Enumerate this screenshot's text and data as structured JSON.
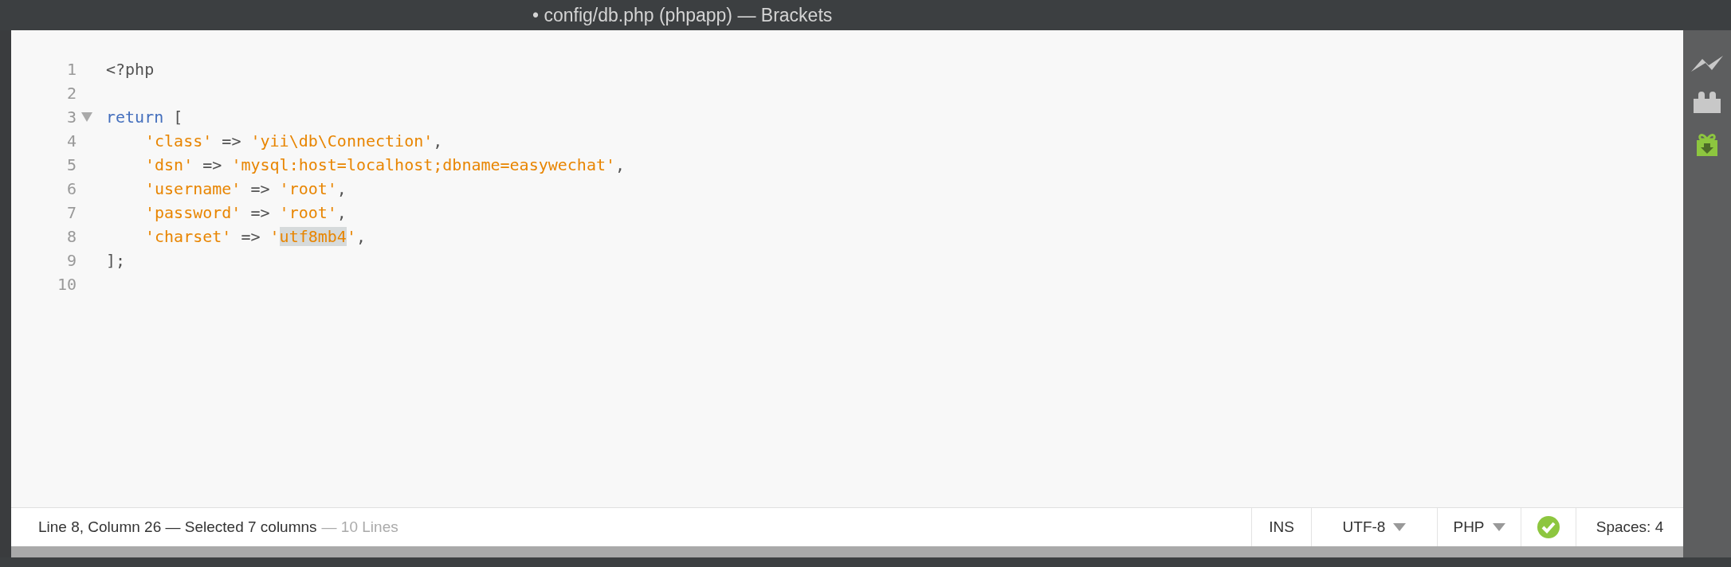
{
  "window": {
    "title": "• config/db.php (phpapp) — Brackets"
  },
  "editor": {
    "lines": [
      {
        "number": "1",
        "fold": false,
        "tokens": [
          {
            "text": "<?php",
            "kind": "plain"
          }
        ]
      },
      {
        "number": "2",
        "fold": false
      },
      {
        "number": "3",
        "fold": true,
        "tokens": [
          {
            "text": "return",
            "kind": "keyword"
          },
          {
            "text": " [",
            "kind": "plain"
          }
        ],
        "children": [
          {
            "number": "4",
            "fold": false,
            "tokens": [
              {
                "text": "'class'",
                "kind": "string"
              },
              {
                "text": " => ",
                "kind": "plain"
              },
              {
                "text": "'yii\\db\\Connection'",
                "kind": "string"
              },
              {
                "text": ",",
                "kind": "plain"
              }
            ]
          },
          {
            "number": "5",
            "fold": false,
            "tokens": [
              {
                "text": "'dsn'",
                "kind": "string"
              },
              {
                "text": " => ",
                "kind": "plain"
              },
              {
                "text": "'mysql:host=localhost;dbname=easywechat'",
                "kind": "string"
              },
              {
                "text": ",",
                "kind": "plain"
              }
            ]
          },
          {
            "number": "6",
            "fold": false,
            "tokens": [
              {
                "text": "'username'",
                "kind": "string"
              },
              {
                "text": " => ",
                "kind": "plain"
              },
              {
                "text": "'root'",
                "kind": "string"
              },
              {
                "text": ",",
                "kind": "plain"
              }
            ]
          },
          {
            "number": "7",
            "fold": false,
            "tokens": [
              {
                "text": "'password'",
                "kind": "string"
              },
              {
                "text": " => ",
                "kind": "plain"
              },
              {
                "text": "'root'",
                "kind": "string"
              },
              {
                "text": ",",
                "kind": "plain"
              }
            ]
          },
          {
            "number": "8",
            "fold": false,
            "tokens": [
              {
                "text": "'charset'",
                "kind": "string"
              },
              {
                "text": " => ",
                "kind": "plain"
              },
              {
                "text": "'",
                "kind": "string"
              },
              {
                "text": "utf8mb4",
                "kind": "selected-string"
              },
              {
                "text": "'",
                "kind": "string"
              },
              {
                "text": ",",
                "kind": "plain"
              }
            ]
          }
        ]
      },
      {
        "number": "9",
        "fold": false,
        "tokens": [
          {
            "text": "];",
            "kind": "plain"
          }
        ]
      },
      {
        "number": "10",
        "fold": false
      }
    ]
  },
  "toolbar": [
    {
      "kind": "live-preview"
    },
    {
      "kind": "extensions"
    },
    {
      "kind": "updates"
    }
  ],
  "status_bar": {
    "position": "Line 8, Column 26 — Selected 7 columns",
    "line_count": "— 10 Lines",
    "mode": "INS",
    "encoding": "UTF-8",
    "language": "PHP",
    "lint_ok": true,
    "indent": "Spaces:  4"
  }
}
